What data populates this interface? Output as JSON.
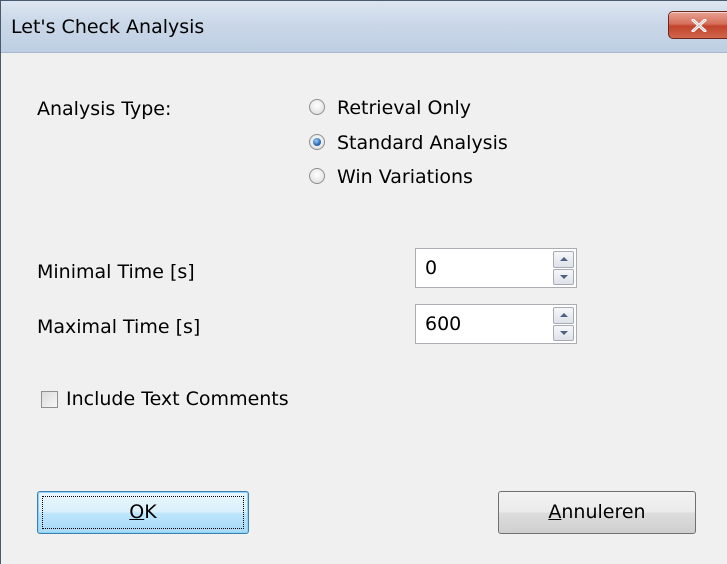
{
  "window": {
    "title": "Let's Check Analysis",
    "close_icon": "close-icon"
  },
  "analysis_type": {
    "label": "Analysis Type:",
    "options": [
      {
        "label": "Retrieval Only",
        "checked": false
      },
      {
        "label": "Standard Analysis",
        "checked": true
      },
      {
        "label": "Win Variations",
        "checked": false
      }
    ]
  },
  "minimal_time": {
    "label": "Minimal Time [s]",
    "value": "0"
  },
  "maximal_time": {
    "label": "Maximal Time [s]",
    "value": "600"
  },
  "include_comments": {
    "label": "Include Text Comments",
    "checked": false
  },
  "buttons": {
    "ok": {
      "mnemonic": "O",
      "rest": "K"
    },
    "cancel": {
      "mnemonic": "A",
      "rest": "nnuleren"
    }
  }
}
